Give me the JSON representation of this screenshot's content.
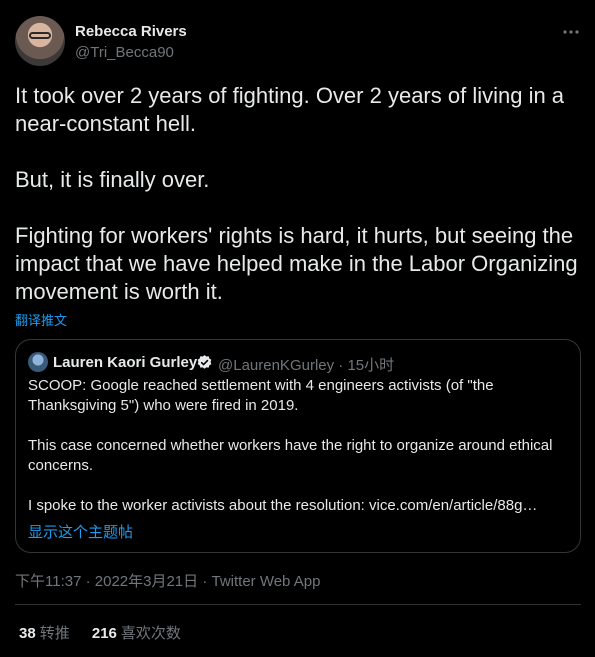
{
  "author": {
    "display_name": "Rebecca Rivers",
    "handle": "@Tri_Becca90"
  },
  "icons": {
    "more": "more-horizontal-icon",
    "verified": "verified-badge-icon"
  },
  "tweet": {
    "text": "It took over 2 years of fighting. Over 2 years of living in a near-constant hell.\n\nBut, it is finally over.\n\nFighting for workers' rights is hard, it hurts, but seeing the impact that we have helped make in the Labor Organizing movement is worth it.",
    "translate_label": "翻译推文"
  },
  "quote": {
    "display_name": "Lauren Kaori Gurley",
    "handle_time": "@LaurenKGurley · 15小时",
    "paragraphs": [
      "SCOOP: Google reached settlement with 4 engineers activists (of \"the Thanksgiving 5\") who were fired in 2019.",
      "This case concerned whether workers have the right to organize around ethical concerns.",
      "I spoke to the worker activists about the resolution: vice.com/en/article/88g…"
    ],
    "show_thread_label": "显示这个主题帖"
  },
  "meta": {
    "time_date": "下午11:37 · 2022年3月21日 · ",
    "source": "Twitter Web App"
  },
  "stats": {
    "retweets_count": "38",
    "retweets_label": "转推",
    "likes_count": "216",
    "likes_label": "喜欢次数"
  },
  "colors": {
    "background": "#000000",
    "text_primary": "#e7e9ea",
    "text_secondary": "#71767b",
    "link": "#1d9bf0",
    "border": "#333639",
    "verified": "#1d9bf0"
  }
}
